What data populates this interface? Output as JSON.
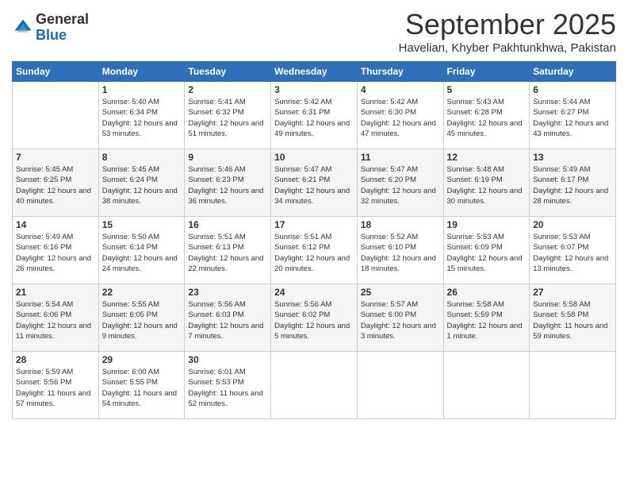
{
  "logo": {
    "general": "General",
    "blue": "Blue"
  },
  "title": "September 2025",
  "location": "Havelian, Khyber Pakhtunkhwa, Pakistan",
  "headers": [
    "Sunday",
    "Monday",
    "Tuesday",
    "Wednesday",
    "Thursday",
    "Friday",
    "Saturday"
  ],
  "weeks": [
    [
      {
        "day": "",
        "sunrise": "",
        "sunset": "",
        "daylight": ""
      },
      {
        "day": "1",
        "sunrise": "Sunrise: 5:40 AM",
        "sunset": "Sunset: 6:34 PM",
        "daylight": "Daylight: 12 hours and 53 minutes."
      },
      {
        "day": "2",
        "sunrise": "Sunrise: 5:41 AM",
        "sunset": "Sunset: 6:32 PM",
        "daylight": "Daylight: 12 hours and 51 minutes."
      },
      {
        "day": "3",
        "sunrise": "Sunrise: 5:42 AM",
        "sunset": "Sunset: 6:31 PM",
        "daylight": "Daylight: 12 hours and 49 minutes."
      },
      {
        "day": "4",
        "sunrise": "Sunrise: 5:42 AM",
        "sunset": "Sunset: 6:30 PM",
        "daylight": "Daylight: 12 hours and 47 minutes."
      },
      {
        "day": "5",
        "sunrise": "Sunrise: 5:43 AM",
        "sunset": "Sunset: 6:28 PM",
        "daylight": "Daylight: 12 hours and 45 minutes."
      },
      {
        "day": "6",
        "sunrise": "Sunrise: 5:44 AM",
        "sunset": "Sunset: 6:27 PM",
        "daylight": "Daylight: 12 hours and 43 minutes."
      }
    ],
    [
      {
        "day": "7",
        "sunrise": "Sunrise: 5:45 AM",
        "sunset": "Sunset: 6:25 PM",
        "daylight": "Daylight: 12 hours and 40 minutes."
      },
      {
        "day": "8",
        "sunrise": "Sunrise: 5:45 AM",
        "sunset": "Sunset: 6:24 PM",
        "daylight": "Daylight: 12 hours and 38 minutes."
      },
      {
        "day": "9",
        "sunrise": "Sunrise: 5:46 AM",
        "sunset": "Sunset: 6:23 PM",
        "daylight": "Daylight: 12 hours and 36 minutes."
      },
      {
        "day": "10",
        "sunrise": "Sunrise: 5:47 AM",
        "sunset": "Sunset: 6:21 PM",
        "daylight": "Daylight: 12 hours and 34 minutes."
      },
      {
        "day": "11",
        "sunrise": "Sunrise: 5:47 AM",
        "sunset": "Sunset: 6:20 PM",
        "daylight": "Daylight: 12 hours and 32 minutes."
      },
      {
        "day": "12",
        "sunrise": "Sunrise: 5:48 AM",
        "sunset": "Sunset: 6:19 PM",
        "daylight": "Daylight: 12 hours and 30 minutes."
      },
      {
        "day": "13",
        "sunrise": "Sunrise: 5:49 AM",
        "sunset": "Sunset: 6:17 PM",
        "daylight": "Daylight: 12 hours and 28 minutes."
      }
    ],
    [
      {
        "day": "14",
        "sunrise": "Sunrise: 5:49 AM",
        "sunset": "Sunset: 6:16 PM",
        "daylight": "Daylight: 12 hours and 26 minutes."
      },
      {
        "day": "15",
        "sunrise": "Sunrise: 5:50 AM",
        "sunset": "Sunset: 6:14 PM",
        "daylight": "Daylight: 12 hours and 24 minutes."
      },
      {
        "day": "16",
        "sunrise": "Sunrise: 5:51 AM",
        "sunset": "Sunset: 6:13 PM",
        "daylight": "Daylight: 12 hours and 22 minutes."
      },
      {
        "day": "17",
        "sunrise": "Sunrise: 5:51 AM",
        "sunset": "Sunset: 6:12 PM",
        "daylight": "Daylight: 12 hours and 20 minutes."
      },
      {
        "day": "18",
        "sunrise": "Sunrise: 5:52 AM",
        "sunset": "Sunset: 6:10 PM",
        "daylight": "Daylight: 12 hours and 18 minutes."
      },
      {
        "day": "19",
        "sunrise": "Sunrise: 5:53 AM",
        "sunset": "Sunset: 6:09 PM",
        "daylight": "Daylight: 12 hours and 15 minutes."
      },
      {
        "day": "20",
        "sunrise": "Sunrise: 5:53 AM",
        "sunset": "Sunset: 6:07 PM",
        "daylight": "Daylight: 12 hours and 13 minutes."
      }
    ],
    [
      {
        "day": "21",
        "sunrise": "Sunrise: 5:54 AM",
        "sunset": "Sunset: 6:06 PM",
        "daylight": "Daylight: 12 hours and 11 minutes."
      },
      {
        "day": "22",
        "sunrise": "Sunrise: 5:55 AM",
        "sunset": "Sunset: 6:05 PM",
        "daylight": "Daylight: 12 hours and 9 minutes."
      },
      {
        "day": "23",
        "sunrise": "Sunrise: 5:56 AM",
        "sunset": "Sunset: 6:03 PM",
        "daylight": "Daylight: 12 hours and 7 minutes."
      },
      {
        "day": "24",
        "sunrise": "Sunrise: 5:56 AM",
        "sunset": "Sunset: 6:02 PM",
        "daylight": "Daylight: 12 hours and 5 minutes."
      },
      {
        "day": "25",
        "sunrise": "Sunrise: 5:57 AM",
        "sunset": "Sunset: 6:00 PM",
        "daylight": "Daylight: 12 hours and 3 minutes."
      },
      {
        "day": "26",
        "sunrise": "Sunrise: 5:58 AM",
        "sunset": "Sunset: 5:59 PM",
        "daylight": "Daylight: 12 hours and 1 minute."
      },
      {
        "day": "27",
        "sunrise": "Sunrise: 5:58 AM",
        "sunset": "Sunset: 5:58 PM",
        "daylight": "Daylight: 11 hours and 59 minutes."
      }
    ],
    [
      {
        "day": "28",
        "sunrise": "Sunrise: 5:59 AM",
        "sunset": "Sunset: 5:56 PM",
        "daylight": "Daylight: 11 hours and 57 minutes."
      },
      {
        "day": "29",
        "sunrise": "Sunrise: 6:00 AM",
        "sunset": "Sunset: 5:55 PM",
        "daylight": "Daylight: 11 hours and 54 minutes."
      },
      {
        "day": "30",
        "sunrise": "Sunrise: 6:01 AM",
        "sunset": "Sunset: 5:53 PM",
        "daylight": "Daylight: 11 hours and 52 minutes."
      },
      {
        "day": "",
        "sunrise": "",
        "sunset": "",
        "daylight": ""
      },
      {
        "day": "",
        "sunrise": "",
        "sunset": "",
        "daylight": ""
      },
      {
        "day": "",
        "sunrise": "",
        "sunset": "",
        "daylight": ""
      },
      {
        "day": "",
        "sunrise": "",
        "sunset": "",
        "daylight": ""
      }
    ]
  ]
}
